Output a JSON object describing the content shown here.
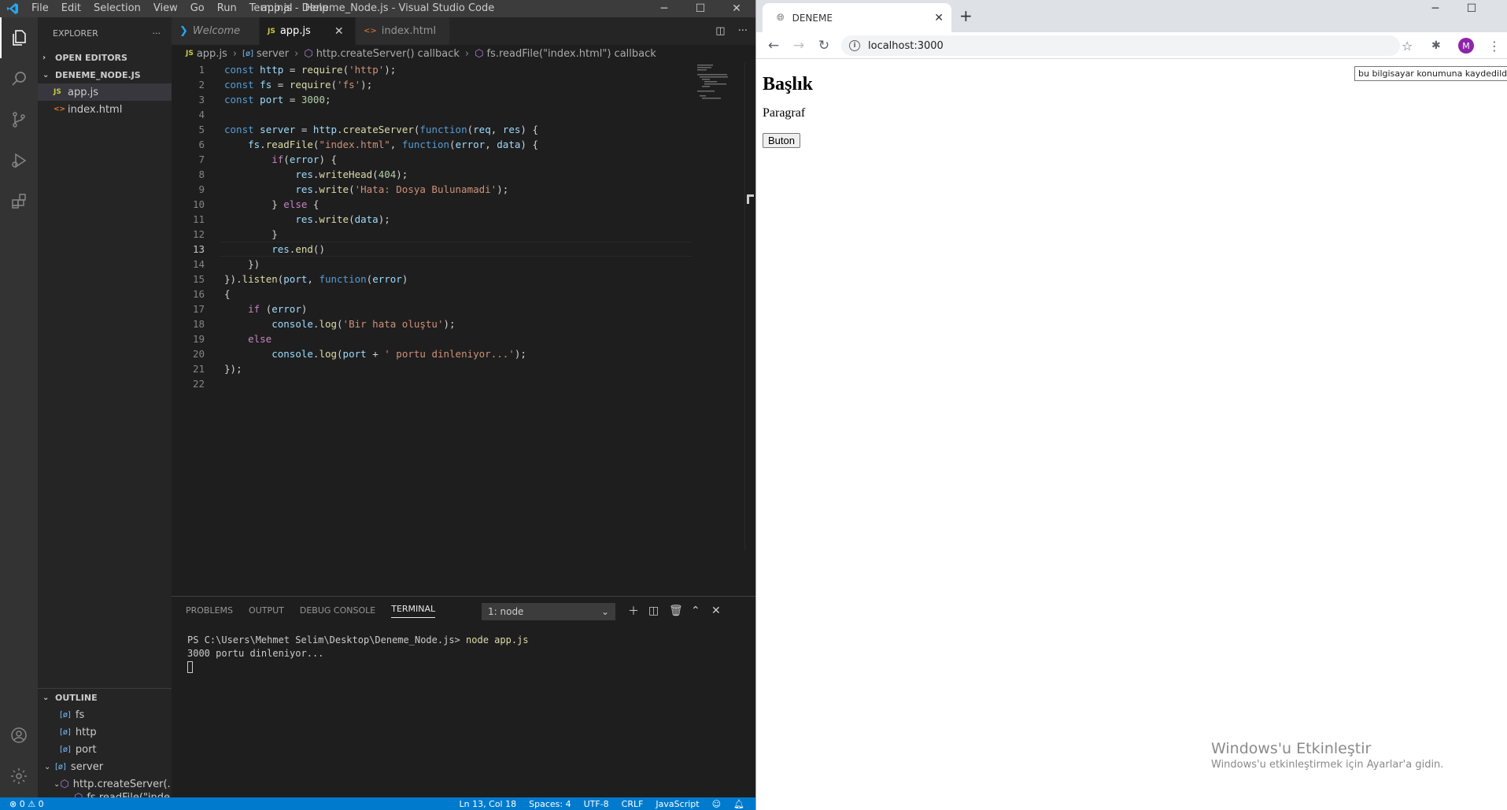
{
  "vscode": {
    "menu": [
      "File",
      "Edit",
      "Selection",
      "View",
      "Go",
      "Run",
      "Terminal",
      "Help"
    ],
    "window_title": "app.js - Deneme_Node.js - Visual Studio Code",
    "explorer": {
      "title": "EXPLORER",
      "open_editors": "OPEN EDITORS",
      "folder": "DENEME_NODE.JS",
      "files": [
        {
          "icon": "JS",
          "name": "app.js"
        },
        {
          "icon": "<>",
          "name": "index.html"
        }
      ]
    },
    "outline": {
      "title": "OUTLINE",
      "items": [
        "fs",
        "http",
        "port",
        "server",
        "http.createServer(...",
        "fs.readFile(\"inde..."
      ]
    },
    "tabs": [
      {
        "label": "Welcome"
      },
      {
        "label": "app.js"
      },
      {
        "label": "index.html"
      }
    ],
    "breadcrumbs": [
      "app.js",
      "server",
      "http.createServer() callback",
      "fs.readFile(\"index.html\") callback"
    ],
    "code_lines": [
      "const http = require('http');",
      "const fs = require('fs');",
      "const port = 3000;",
      "",
      "const server = http.createServer(function(req, res) {",
      "    fs.readFile(\"index.html\", function(error, data) {",
      "        if(error) {",
      "            res.writeHead(404);",
      "            res.write('Hata: Dosya Bulunamadi');",
      "        } else {",
      "            res.write(data);",
      "        }",
      "        res.end()",
      "    })",
      "}).listen(port, function(error)",
      "{",
      "    if (error)",
      "        console.log('Bir hata oluştu');",
      "    else",
      "        console.log(port + ' portu dinleniyor...');",
      "});",
      ""
    ],
    "panel": {
      "tabs": [
        "PROBLEMS",
        "OUTPUT",
        "DEBUG CONSOLE",
        "TERMINAL"
      ],
      "terminal_select": "1: node",
      "prompt": "PS C:\\Users\\Mehmet Selim\\Desktop\\Deneme_Node.js>",
      "command": "node app.js",
      "output": "3000 portu dinleniyor..."
    },
    "status": {
      "problems": "⊗ 0 ⚠ 0",
      "position": "Ln 13, Col 18",
      "spaces": "Spaces: 4",
      "encoding": "UTF-8",
      "eol": "CRLF",
      "language": "JavaScript"
    },
    "colors": {
      "accent": "#007acc",
      "activity": "#333333",
      "sidebar": "#252526"
    }
  },
  "browser": {
    "tab_title": "DENEME",
    "url": "localhost:3000",
    "avatar_letter": "M",
    "tooltip": "bu bilgisayar konumuna kaydedildi",
    "page": {
      "heading": "Başlık",
      "paragraph": "Paragraf",
      "button": "Buton"
    },
    "watermark": {
      "line1": "Windows'u Etkinleştir",
      "line2": "Windows'u etkinleştirmek için Ayarlar'a gidin."
    }
  }
}
